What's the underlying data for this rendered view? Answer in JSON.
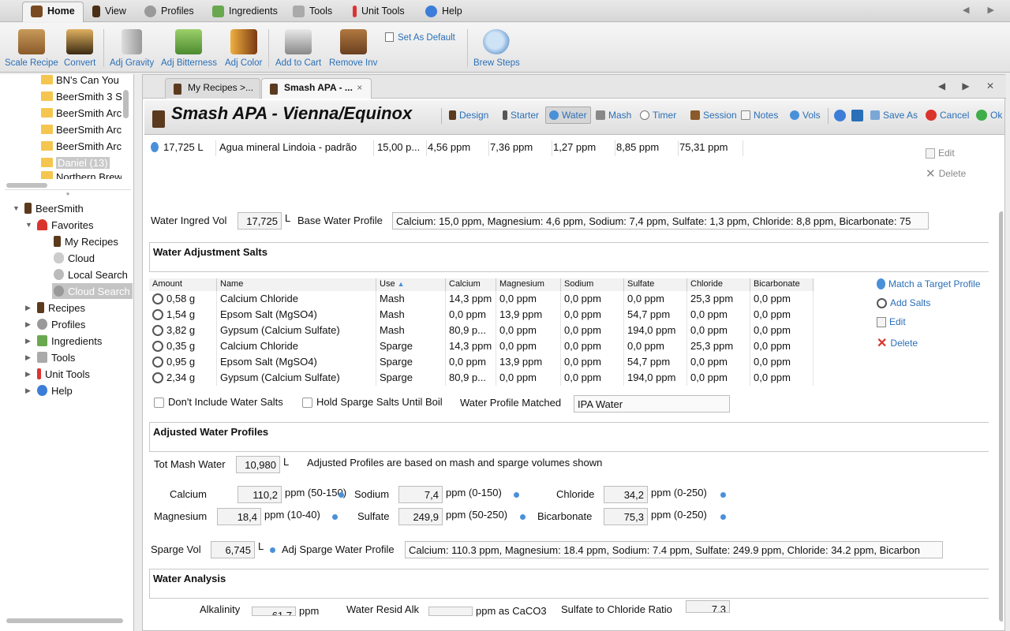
{
  "menubar": {
    "tabs": [
      {
        "label": "Home",
        "icon": "brew-kettle-icon"
      },
      {
        "label": "View",
        "icon": "mug-icon"
      },
      {
        "label": "Profiles",
        "icon": "gear-icon"
      },
      {
        "label": "Ingredients",
        "icon": "hops-icon"
      },
      {
        "label": "Tools",
        "icon": "wrench-icon"
      },
      {
        "label": "Unit Tools",
        "icon": "thermometer-icon"
      },
      {
        "label": "Help",
        "icon": "help-icon"
      }
    ],
    "nav": "◀ ▶"
  },
  "ribbon": {
    "buttons": [
      "Scale Recipe",
      "Convert",
      "Adj Gravity",
      "Adj Bitterness",
      "Adj Color",
      "Add to Cart",
      "Remove Inv",
      "Brew Steps"
    ],
    "set_default": "Set As Default"
  },
  "tree": {
    "folders": [
      "BN's Can You",
      "BeerSmith 3 S",
      "BeerSmith Arc",
      "BeerSmith Arc",
      "BeerSmith Arc",
      "Daniel (13)",
      "Northern Brew"
    ],
    "items": [
      {
        "label": "BeerSmith",
        "level": 0
      },
      {
        "label": "Favorites",
        "level": 1
      },
      {
        "label": "My Recipes",
        "level": 2
      },
      {
        "label": "Cloud",
        "level": 2
      },
      {
        "label": "Local Search",
        "level": 2
      },
      {
        "label": "Cloud Search",
        "level": 2
      },
      {
        "label": "Recipes",
        "level": 1
      },
      {
        "label": "Profiles",
        "level": 1
      },
      {
        "label": "Ingredients",
        "level": 1
      },
      {
        "label": "Tools",
        "level": 1
      },
      {
        "label": "Unit Tools",
        "level": 1
      },
      {
        "label": "Help",
        "level": 1
      }
    ]
  },
  "doctabs": {
    "tab1": "My Recipes >...",
    "tab2": "Smash APA - ...",
    "close": "×",
    "controls": "◀ ▶ ✕"
  },
  "recipe": {
    "title": "Smash APA - Vienna/Equinox",
    "toolbar": [
      "Design",
      "Starter",
      "Water",
      "Mash",
      "Timer",
      "Session",
      "Notes",
      "Vols",
      "Save As",
      "Cancel",
      "Ok"
    ]
  },
  "water_row": {
    "amount": "17,725 L",
    "name": "Agua mineral Lindoia - padrão",
    "calcium": "15,00 p...",
    "magnesium": "4,56 ppm",
    "sodium": "7,36 ppm",
    "sulfate": "1,27 ppm",
    "chloride": "8,85 ppm",
    "bicarbonate": "75,31 ppm"
  },
  "water_side": {
    "edit": "Edit",
    "delete": "Delete"
  },
  "water_ingred": {
    "label": "Water Ingred Vol",
    "value": "17,725",
    "unit": "L",
    "base_label": "Base Water Profile",
    "base_value": "Calcium: 15,0 ppm, Magnesium: 4,6 ppm, Sodium: 7,4 ppm, Sulfate: 1,3 ppm, Chloride: 8,8 ppm, Bicarbonate: 75"
  },
  "salts_section": "Water Adjustment Salts",
  "salts": {
    "headers": [
      "Amount",
      "Name",
      "Use",
      "Calcium",
      "Magnesium",
      "Sodium",
      "Sulfate",
      "Chloride",
      "Bicarbonate"
    ],
    "rows": [
      [
        "0,58 g",
        "Calcium Chloride",
        "Mash",
        "14,3 ppm",
        "0,0 ppm",
        "0,0 ppm",
        "0,0 ppm",
        "25,3 ppm",
        "0,0 ppm"
      ],
      [
        "1,54 g",
        "Epsom Salt (MgSO4)",
        "Mash",
        "0,0 ppm",
        "13,9 ppm",
        "0,0 ppm",
        "54,7 ppm",
        "0,0 ppm",
        "0,0 ppm"
      ],
      [
        "3,82 g",
        "Gypsum (Calcium Sulfate)",
        "Mash",
        "80,9 p...",
        "0,0 ppm",
        "0,0 ppm",
        "194,0 ppm",
        "0,0 ppm",
        "0,0 ppm"
      ],
      [
        "0,35 g",
        "Calcium Chloride",
        "Sparge",
        "14,3 ppm",
        "0,0 ppm",
        "0,0 ppm",
        "0,0 ppm",
        "25,3 ppm",
        "0,0 ppm"
      ],
      [
        "0,95 g",
        "Epsom Salt (MgSO4)",
        "Sparge",
        "0,0 ppm",
        "13,9 ppm",
        "0,0 ppm",
        "54,7 ppm",
        "0,0 ppm",
        "0,0 ppm"
      ],
      [
        "2,34 g",
        "Gypsum (Calcium Sulfate)",
        "Sparge",
        "80,9 p...",
        "0,0 ppm",
        "0,0 ppm",
        "194,0 ppm",
        "0,0 ppm",
        "0,0 ppm"
      ]
    ],
    "side": {
      "match": "Match a Target Profile",
      "add": "Add Salts",
      "edit": "Edit",
      "delete": "Delete"
    }
  },
  "options": {
    "dont_include": "Don't Include Water Salts",
    "hold_sparge": "Hold Sparge Salts Until Boil",
    "matched_label": "Water Profile Matched",
    "matched_value": "IPA Water"
  },
  "adjusted_section": "Adjusted Water Profiles",
  "adjusted": {
    "tot_label": "Tot Mash Water",
    "tot_value": "10,980",
    "unit": "L",
    "note": "Adjusted Profiles are based on mash and sparge volumes shown",
    "calcium": {
      "label": "Calcium",
      "value": "110,2",
      "range": "ppm (50-150)"
    },
    "magnesium": {
      "label": "Magnesium",
      "value": "18,4",
      "range": "ppm (10-40)"
    },
    "sodium": {
      "label": "Sodium",
      "value": "7,4",
      "range": "ppm (0-150)"
    },
    "sulfate": {
      "label": "Sulfate",
      "value": "249,9",
      "range": "ppm (50-250)"
    },
    "chloride": {
      "label": "Chloride",
      "value": "34,2",
      "range": "ppm (0-250)"
    },
    "bicarbonate": {
      "label": "Bicarbonate",
      "value": "75,3",
      "range": "ppm (0-250)"
    },
    "sparge_label": "Sparge Vol",
    "sparge_value": "6,745",
    "sparge_unit": "L",
    "adj_label": "Adj Sparge Water Profile",
    "adj_value": "Calcium: 110.3 ppm, Magnesium: 18.4 ppm, Sodium: 7.4 ppm, Sulfate: 249.9 ppm, Chloride: 34.2 ppm, Bicarbon"
  },
  "analysis_section": "Water Analysis",
  "analysis": {
    "alk_label": "Alkalinity",
    "alk_value": "61,7",
    "alk_unit": "ppm",
    "resid_label": "Water Resid Alk",
    "resid_unit": "ppm as CaCO3",
    "ratio_label": "Sulfate to Chloride Ratio",
    "ratio_value": "7,3"
  },
  "colors": {
    "accent": "#2a6fb8",
    "folder": "#f5c64f"
  }
}
